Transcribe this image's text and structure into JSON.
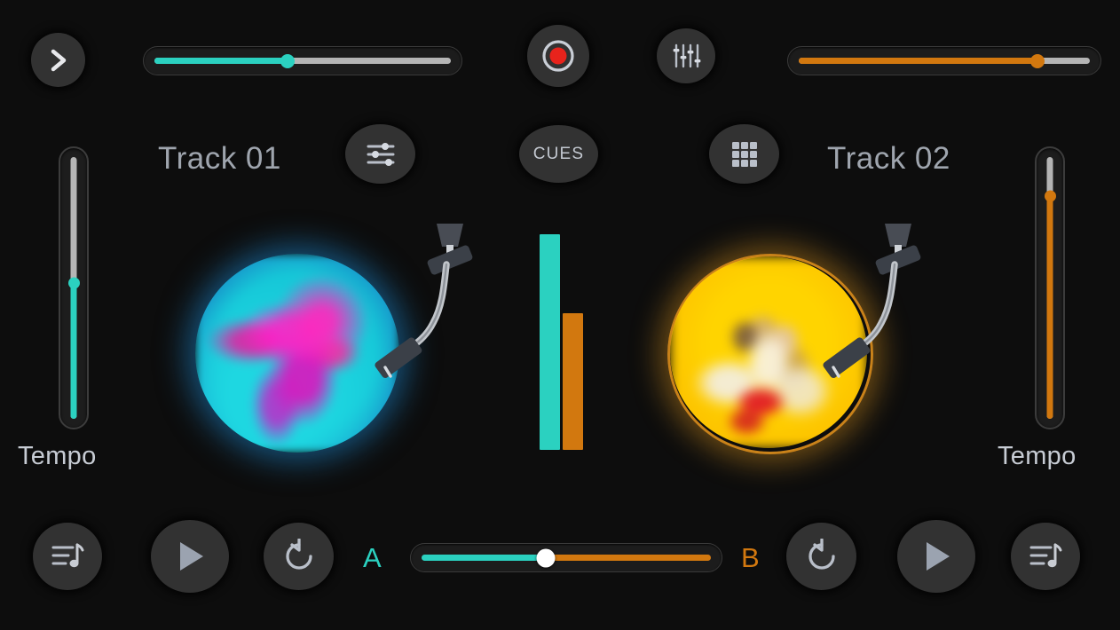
{
  "colors": {
    "background": "#0d0d0d",
    "button": "#323232",
    "teal": "#2bd1c0",
    "orange": "#d2780f",
    "record_red": "#e8231c",
    "icon": "#b9bfc9",
    "text": "#9fa5ae",
    "slider_track": "#b5b5b5"
  },
  "topbar": {
    "expand_button": {
      "icon": "chevron-right-icon"
    },
    "left_slider": {
      "label": "deck-a-volume",
      "value": 45,
      "min": 0,
      "max": 100,
      "color": "#2bd1c0"
    },
    "record_button": {
      "icon": "record-icon",
      "label": "REC",
      "active": true
    },
    "mixer_button": {
      "icon": "mixer-faders-icon"
    },
    "right_slider": {
      "label": "deck-b-volume",
      "value": 82,
      "min": 0,
      "max": 100,
      "color": "#d2780f"
    }
  },
  "decks": {
    "left": {
      "title": "Track 01",
      "eq_button": {
        "icon": "eq-sliders-icon"
      },
      "tempo": {
        "label": "Tempo",
        "value": 52,
        "min": 0,
        "max": 100,
        "color": "#2bd1c0"
      },
      "artwork": "cyan-magenta-smoke",
      "accent": "#2bd1c0"
    },
    "right": {
      "title": "Track 02",
      "pads_button": {
        "icon": "grid-pads-icon"
      },
      "tempo": {
        "label": "Tempo",
        "value": 85,
        "min": 0,
        "max": 100,
        "color": "#d2780f"
      },
      "artwork": "yellow-portrait",
      "accent": "#d2780f"
    }
  },
  "center": {
    "cues_button": {
      "label": "CUES"
    },
    "vu_meters": [
      {
        "channel": "A",
        "level": 100,
        "color": "#2bd1c0"
      },
      {
        "channel": "B",
        "level": 64,
        "color": "#d2780f"
      }
    ]
  },
  "transport": {
    "left": [
      {
        "name": "playlist-button-a",
        "icon": "playlist-music-icon"
      },
      {
        "name": "play-button-a",
        "icon": "play-icon"
      },
      {
        "name": "loop-button-a",
        "icon": "loop-back-icon"
      }
    ],
    "right": [
      {
        "name": "loop-button-b",
        "icon": "loop-back-icon"
      },
      {
        "name": "play-button-b",
        "icon": "play-icon"
      },
      {
        "name": "playlist-button-b",
        "icon": "playlist-music-icon"
      }
    ]
  },
  "crossfader": {
    "label_a": "A",
    "label_b": "B",
    "value": 43,
    "min": 0,
    "max": 100,
    "color_a": "#2bd1c0",
    "color_b": "#d2780f"
  }
}
